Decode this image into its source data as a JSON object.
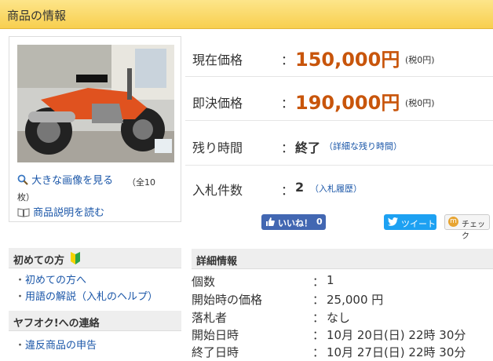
{
  "header": {
    "title": "商品の情報"
  },
  "image_panel": {
    "larger_image_link": "大きな画像を見る",
    "image_count": "（全10枚）",
    "description_link": "商品説明を読む"
  },
  "pricing": {
    "current_label": "現在価格",
    "current_value": "150,000円",
    "current_tax": "(税0円)",
    "buyout_label": "即決価格",
    "buyout_value": "190,000円",
    "buyout_tax": "(税0円)",
    "remaining_label": "残り時間",
    "remaining_value": "終了",
    "remaining_link": "（詳細な残り時間）",
    "bids_label": "入札件数",
    "bids_value": "2",
    "bids_link": "（入札履歴）",
    "colon": "："
  },
  "social": {
    "like_label": "いいね！",
    "like_count": "0",
    "tweet_label": "ツイート",
    "check_label": "チェック"
  },
  "sidebar": {
    "section1_title": "初めての方",
    "section1_items": [
      "初めての方へ",
      "用語の解説（入札のヘルプ）"
    ],
    "section2_title": "ヤフオク!への連絡",
    "section2_items": [
      "違反商品の申告"
    ]
  },
  "details": {
    "title": "詳細情報",
    "rows": [
      {
        "label": "個数",
        "value": "1"
      },
      {
        "label": "開始時の価格",
        "value": "25,000 円"
      },
      {
        "label": "落札者",
        "value": "なし"
      },
      {
        "label": "開始日時",
        "value": "10月 20日(日) 22時 30分"
      },
      {
        "label": "終了日時",
        "value": "10月 27日(日) 22時 30分"
      }
    ]
  },
  "colors": {
    "price": "#c8550b",
    "link": "#1a56a8",
    "header_bg": "#f8cf4f"
  }
}
